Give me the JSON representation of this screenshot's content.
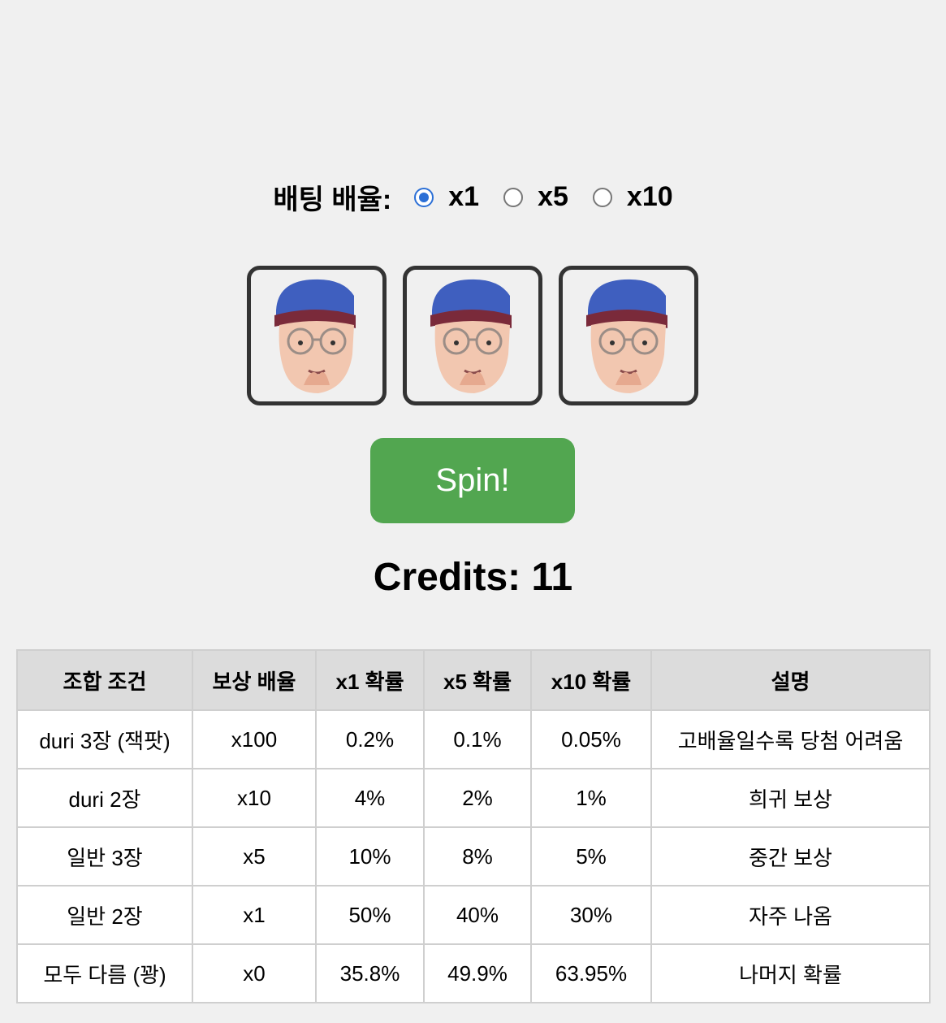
{
  "bet": {
    "label": "배팅 배율:",
    "options": [
      {
        "label": "x1",
        "checked": true
      },
      {
        "label": "x5",
        "checked": false
      },
      {
        "label": "x10",
        "checked": false
      }
    ]
  },
  "reels": [
    {
      "symbol": "duri-face-icon"
    },
    {
      "symbol": "duri-face-icon"
    },
    {
      "symbol": "duri-face-icon"
    }
  ],
  "spin": {
    "label": "Spin!"
  },
  "credits": {
    "text": "Credits: 11"
  },
  "table": {
    "headers": [
      "조합 조건",
      "보상 배율",
      "x1 확률",
      "x5 확률",
      "x10 확률",
      "설명"
    ],
    "rows": [
      [
        "duri 3장 (잭팟)",
        "x100",
        "0.2%",
        "0.1%",
        "0.05%",
        "고배율일수록 당첨 어려움"
      ],
      [
        "duri 2장",
        "x10",
        "4%",
        "2%",
        "1%",
        "희귀 보상"
      ],
      [
        "일반 3장",
        "x5",
        "10%",
        "8%",
        "5%",
        "중간 보상"
      ],
      [
        "일반 2장",
        "x1",
        "50%",
        "40%",
        "30%",
        "자주 나옴"
      ],
      [
        "모두 다름 (꽝)",
        "x0",
        "35.8%",
        "49.9%",
        "63.95%",
        "나머지 확률"
      ]
    ]
  },
  "colors": {
    "spin_button": "#52a650",
    "radio_accent": "#2b6fd6",
    "background": "#f0f0f0"
  }
}
